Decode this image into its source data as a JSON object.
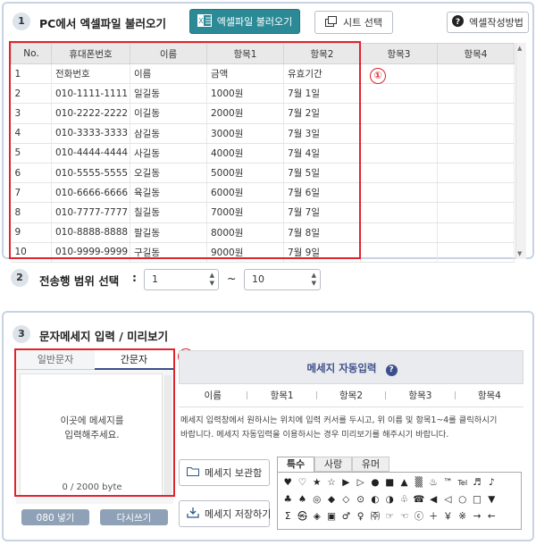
{
  "section1": {
    "step": "1",
    "title": "PC에서 엑셀파일 불러오기",
    "load_button": "엑셀파일 불러오기",
    "sheet_button": "시트 선택",
    "help_button": "엑셀작성방법"
  },
  "table": {
    "headers": [
      "No.",
      "휴대폰번호",
      "이름",
      "항목1",
      "항목2",
      "항목3",
      "항목4"
    ],
    "rows": [
      [
        "1",
        "전화번호",
        "이름",
        "금액",
        "유효기간",
        "",
        ""
      ],
      [
        "2",
        "010-1111-1111",
        "일길동",
        "1000원",
        "7월 1일",
        "",
        ""
      ],
      [
        "3",
        "010-2222-2222",
        "이길동",
        "2000원",
        "7월 2일",
        "",
        ""
      ],
      [
        "4",
        "010-3333-3333",
        "삼길동",
        "3000원",
        "7월 3일",
        "",
        ""
      ],
      [
        "5",
        "010-4444-4444",
        "사길동",
        "4000원",
        "7월 4일",
        "",
        ""
      ],
      [
        "6",
        "010-5555-5555",
        "오길동",
        "5000원",
        "7월 5일",
        "",
        ""
      ],
      [
        "7",
        "010-6666-6666",
        "육길동",
        "6000원",
        "7월 6일",
        "",
        ""
      ],
      [
        "8",
        "010-7777-7777",
        "칠길동",
        "7000원",
        "7월 7일",
        "",
        ""
      ],
      [
        "9",
        "010-8888-8888",
        "팔길동",
        "8000원",
        "7월 8일",
        "",
        ""
      ],
      [
        "10",
        "010-9999-9999",
        "구길동",
        "9000원",
        "7월 9일",
        "",
        ""
      ]
    ]
  },
  "annotation1": "①",
  "annotation2": "②",
  "section2": {
    "step": "2",
    "title": "전송행 범위 선택",
    "colon": ":",
    "from": "1",
    "tilde": "~",
    "to": "10"
  },
  "section3": {
    "step": "3",
    "title": "문자메세지 입력 / 미리보기",
    "tabs": [
      "일반문자",
      "간문자"
    ],
    "placeholder_line1": "이곳에 메세지를",
    "placeholder_line2": "입력해주세요.",
    "byte_count": "0 / 2000 byte",
    "btn_080": "080 넣기",
    "btn_rewrite": "다시쓰기",
    "auto_title": "메세지 자동입력",
    "auto_fields": [
      "이름",
      "항목1",
      "항목2",
      "항목3",
      "항목4"
    ],
    "desc_line1": "메세지 입력창에서 원하시는 위치에 입력 커서를 두시고, 위 이름 및 항목1~4를 클릭하시기",
    "desc_line2": "바랍니다. 메세지 자동입력을 이용하시는 경우 미리보기를 해주시기 바랍니다.",
    "storage_btn": "메세지 보관함",
    "save_btn": "메세지 저장하기",
    "sym_tabs": [
      "특수",
      "사랑",
      "유머"
    ],
    "symbols": [
      [
        "♥",
        "♡",
        "★",
        "☆",
        "▶",
        "▷",
        "●",
        "■",
        "▲",
        "▒",
        "♨",
        "™",
        "Tel",
        "♬",
        "♪"
      ],
      [
        "♣",
        "♠",
        "◎",
        "◆",
        "◇",
        "⊙",
        "◐",
        "◑",
        "♧",
        "☎",
        "◀",
        "◁",
        "○",
        "□",
        "▼"
      ],
      [
        "Σ",
        "㉿",
        "◈",
        "▣",
        "♂",
        "♀",
        "㈜",
        "☞",
        "☜",
        "ⓒ",
        "＋",
        "￥",
        "※",
        "→",
        "←"
      ]
    ]
  },
  "colors": {
    "teal": "#2b8a96",
    "red": "#e0242c",
    "panel_border": "#c7d3e3",
    "accent_blue": "#3d4f8a"
  }
}
